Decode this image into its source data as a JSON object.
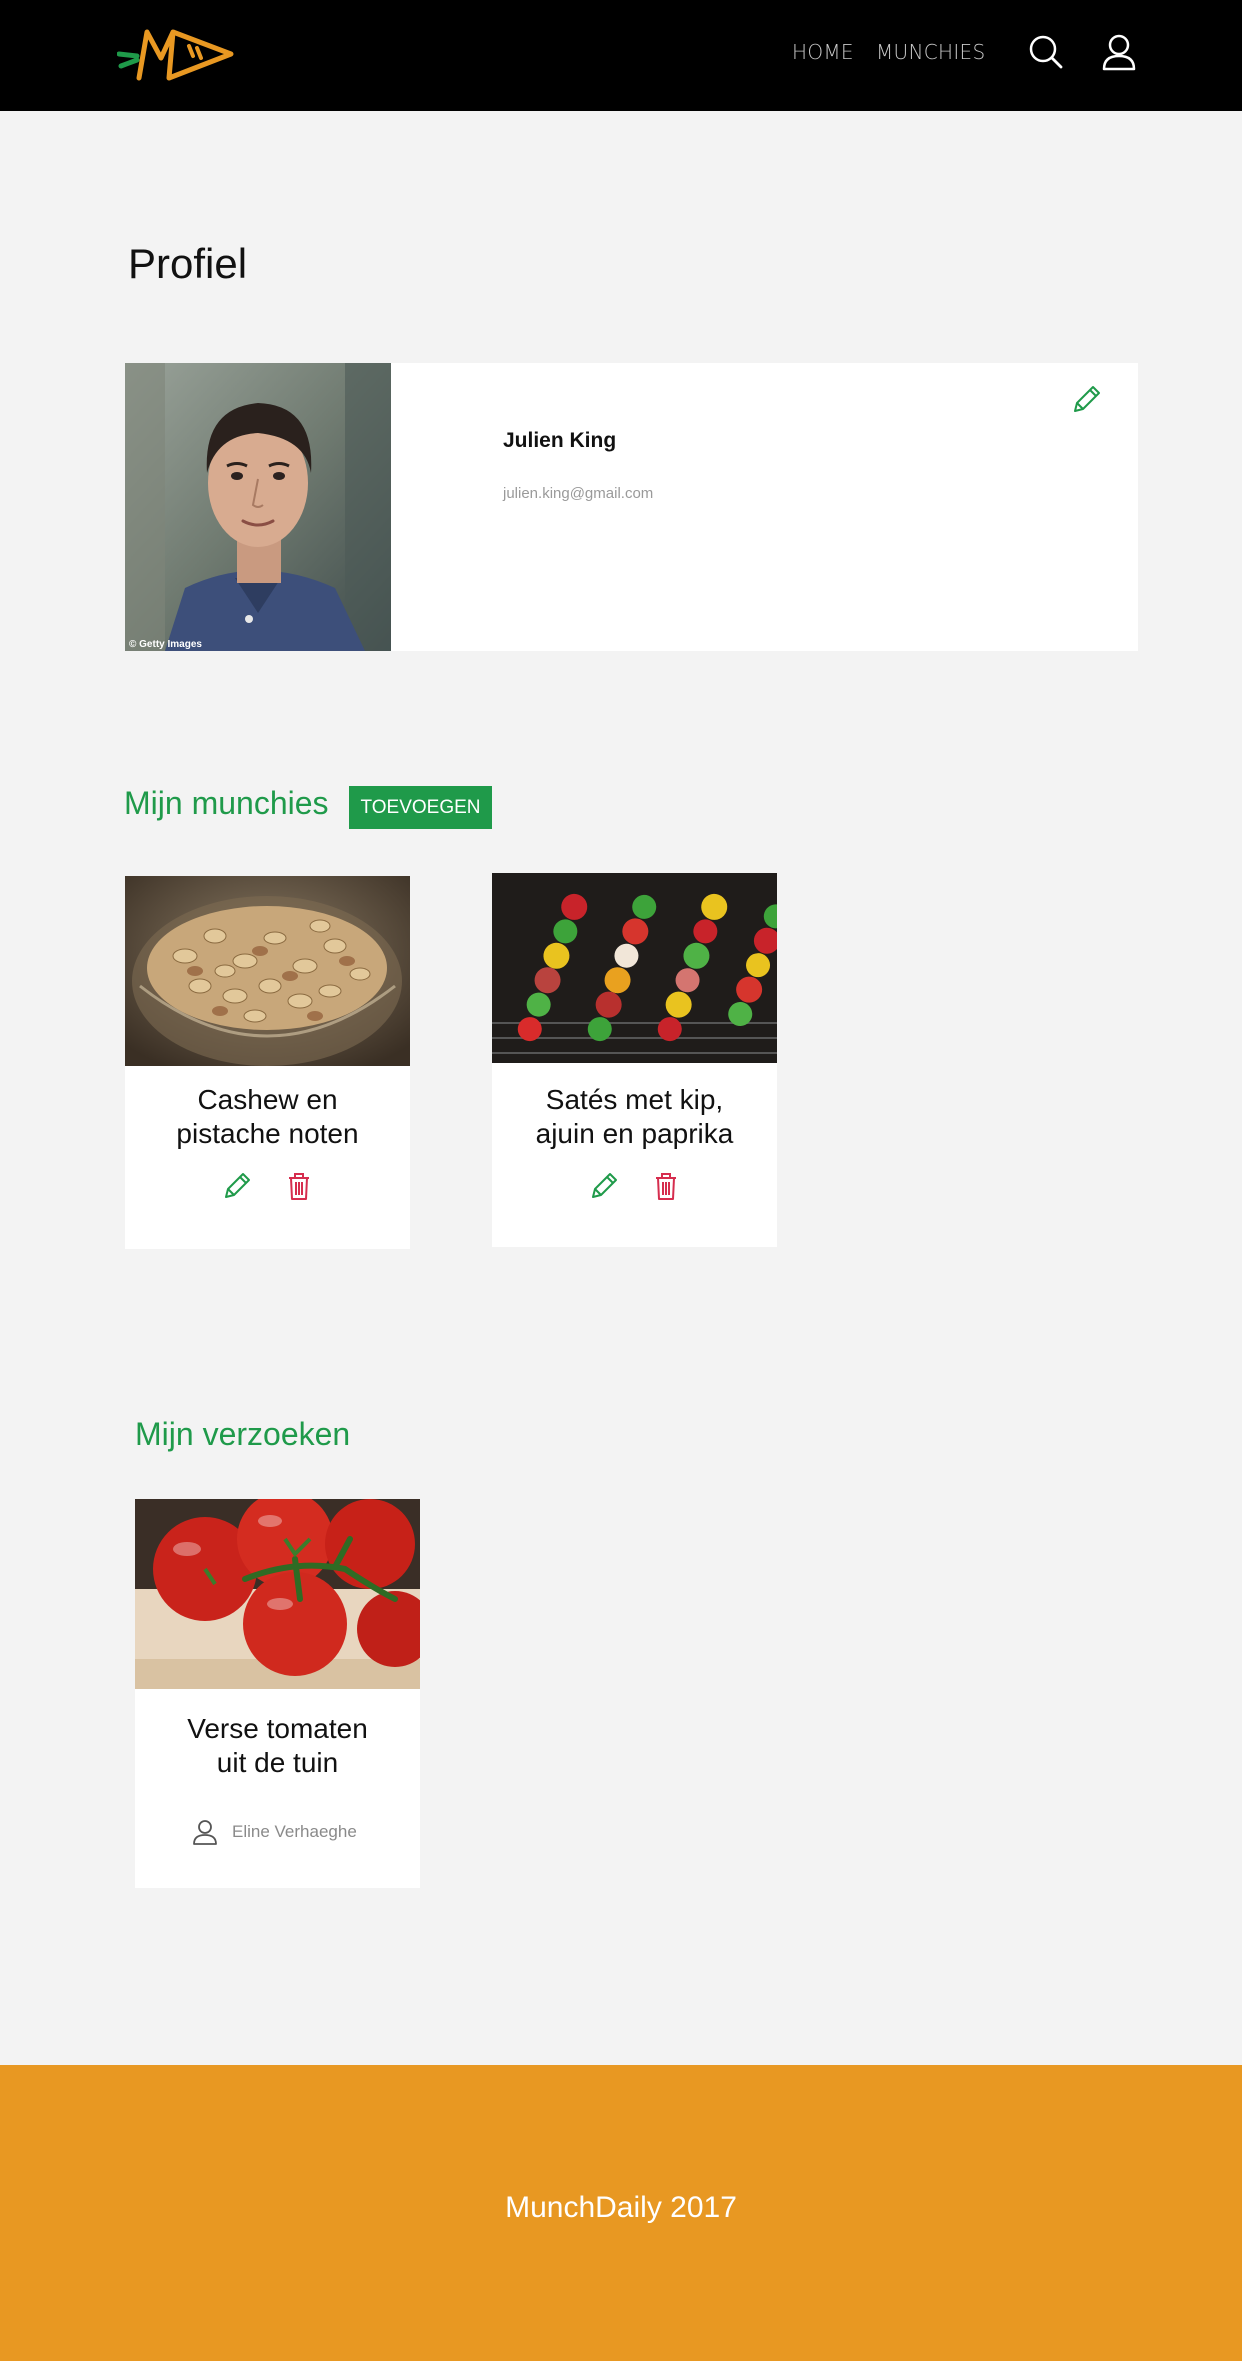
{
  "header": {
    "logo_icon": "munchdaily-logo",
    "nav": [
      {
        "label": "HOME"
      },
      {
        "label": "MUNCHIES"
      }
    ],
    "icons": [
      "search-icon",
      "user-icon"
    ]
  },
  "profile": {
    "title": "Profiel",
    "name": "Julien King",
    "email": "julien.king@gmail.com",
    "photo_credit": "© Getty Images"
  },
  "munchies": {
    "title": "Mijn munchies",
    "add_label": "TOEVOEGEN",
    "items": [
      {
        "title_line1": "Cashew en",
        "title_line2": "pistache noten",
        "image": "nuts-bowl-image"
      },
      {
        "title_line1": "Satés met kip,",
        "title_line2": "ajuin en paprika",
        "image": "skewers-image"
      }
    ]
  },
  "requests": {
    "title": "Mijn verzoeken",
    "items": [
      {
        "title_line1": "Verse tomaten",
        "title_line2": "uit de tuin",
        "user": "Eline Verhaeghe",
        "image": "tomatoes-image"
      }
    ]
  },
  "footer": {
    "text": "MunchDaily 2017"
  },
  "colors": {
    "accent_green": "#1f9a4a",
    "delete_red": "#d62d4e",
    "footer_orange": "#e89822",
    "header_black": "#000000"
  }
}
